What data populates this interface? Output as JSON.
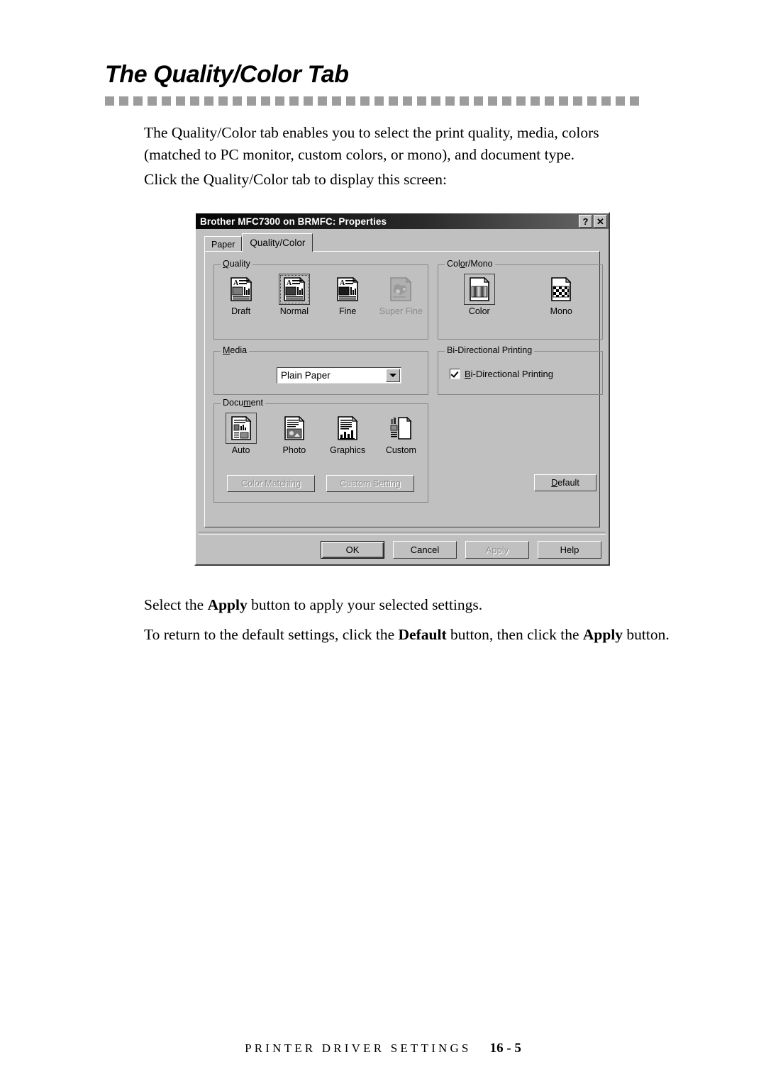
{
  "page": {
    "heading": "The Quality/Color Tab",
    "rule_dash_count": 38,
    "paragraphs": {
      "intro_line1": "The Quality/Color tab enables you to select the print quality, media, colors",
      "intro_line2": "(matched to PC monitor, custom colors, or mono), and document type.",
      "click": "Click the Quality/Color tab to display this screen:",
      "apply_pre": "Select the ",
      "apply_bold": "Apply",
      "apply_post": " button to apply your selected settings.",
      "default_pre": "To return to the default settings, click the ",
      "default_bold1": "Default",
      "default_mid": " button, then click the ",
      "default_bold2": "Apply",
      "default_post": " button."
    },
    "footer": {
      "label": "PRINTER DRIVER SETTINGS",
      "page_number": "16 - 5"
    }
  },
  "dialog": {
    "title": "Brother MFC7300 on BRMFC: Properties",
    "title_buttons": [
      {
        "name": "help-button",
        "glyph": "?"
      },
      {
        "name": "close-button",
        "glyph": "✕"
      }
    ],
    "tabs": [
      {
        "label": "Paper",
        "active": false
      },
      {
        "label": "Quality/Color",
        "active": true
      }
    ],
    "groups": {
      "quality": {
        "title": "Quality",
        "options": [
          {
            "label": "Draft",
            "icon": "draft-quality-icon",
            "selected": false,
            "disabled": false
          },
          {
            "label": "Normal",
            "icon": "normal-quality-icon",
            "selected": true,
            "disabled": false
          },
          {
            "label": "Fine",
            "icon": "fine-quality-icon",
            "selected": false,
            "disabled": false
          },
          {
            "label": "Super Fine",
            "icon": "super-fine-quality-icon",
            "selected": false,
            "disabled": true
          }
        ]
      },
      "color_mono": {
        "title": "Color/Mono",
        "options": [
          {
            "label": "Color",
            "icon": "color-page-icon",
            "selected": true,
            "disabled": false
          },
          {
            "label": "Mono",
            "icon": "mono-page-icon",
            "selected": false,
            "disabled": false
          }
        ]
      },
      "media": {
        "title": "Media",
        "combo_value": "Plain Paper",
        "combo_arrow_icon": "chevron-down-icon"
      },
      "bidirectional": {
        "title": "Bi-Directional Printing",
        "checkbox_label": "Bi-Directional Printing",
        "checked": true
      },
      "document": {
        "title": "Document",
        "options": [
          {
            "label": "Auto",
            "icon": "auto-document-icon",
            "selected": true,
            "disabled": false
          },
          {
            "label": "Photo",
            "icon": "photo-document-icon",
            "selected": false,
            "disabled": false
          },
          {
            "label": "Graphics",
            "icon": "graphics-document-icon",
            "selected": false,
            "disabled": false
          },
          {
            "label": "Custom",
            "icon": "custom-document-icon",
            "selected": false,
            "disabled": false
          }
        ],
        "buttons": [
          {
            "label": "Color Matching",
            "disabled": true
          },
          {
            "label": "Custom Setting",
            "disabled": true
          }
        ]
      }
    },
    "default_button": {
      "label": "Default",
      "disabled": false
    },
    "action_buttons": [
      {
        "label": "OK",
        "disabled": false,
        "is_default": true
      },
      {
        "label": "Cancel",
        "disabled": false,
        "is_default": false
      },
      {
        "label": "Apply",
        "disabled": true,
        "is_default": false
      },
      {
        "label": "Help",
        "disabled": false,
        "is_default": false
      }
    ]
  },
  "colors": {
    "dialog_face": "#c0c0c0",
    "titlebar_dark": "#050505",
    "rule_gray": "#9c9c9c",
    "disabled_text": "#8e8e8e"
  }
}
